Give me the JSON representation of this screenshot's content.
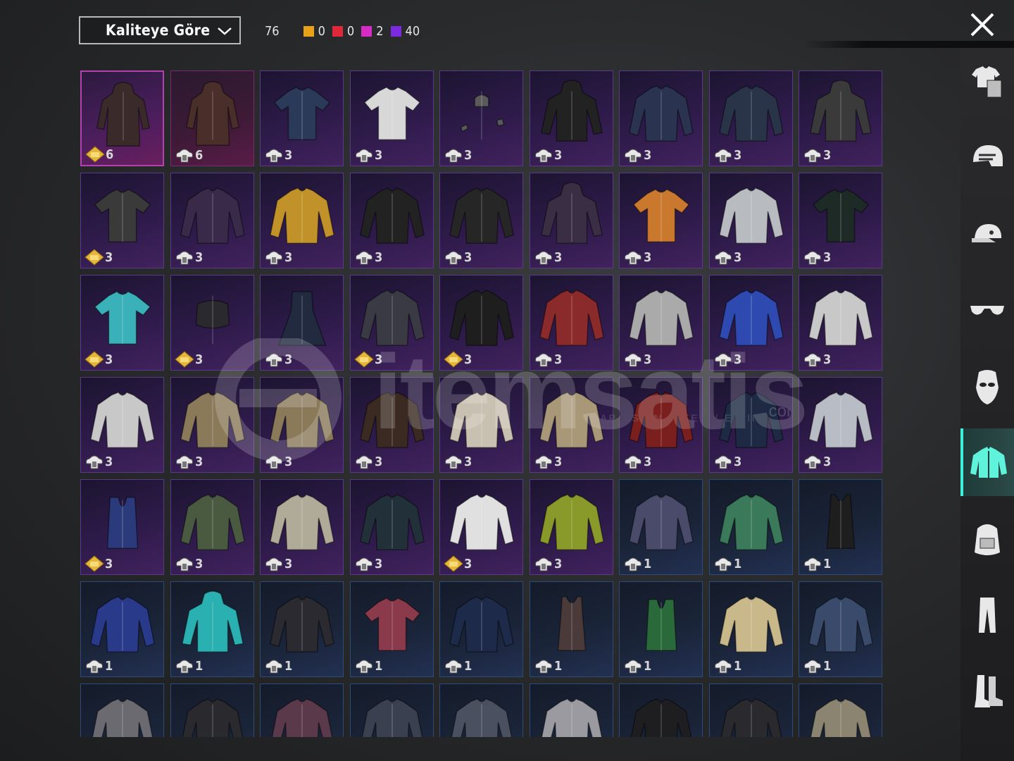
{
  "sort": {
    "label": "Kaliteye Göre"
  },
  "counts": {
    "total": "76",
    "items": [
      {
        "color": "#e8a21a",
        "value": "0"
      },
      {
        "color": "#e0283a",
        "value": "0"
      },
      {
        "color": "#d62bc4",
        "value": "2"
      },
      {
        "color": "#7b2ae0",
        "value": "40"
      }
    ]
  },
  "watermark": {
    "text": "itemsatis",
    "sub": "SAP / SKIN / ITEM / E-PIN",
    "com": ".com"
  },
  "sidebar": {
    "items": [
      {
        "name": "outfit",
        "icon": "outfit-icon",
        "active": false
      },
      {
        "name": "helmet",
        "icon": "helmet-icon",
        "active": false
      },
      {
        "name": "hat",
        "icon": "cap-icon",
        "active": false
      },
      {
        "name": "glasses",
        "icon": "glasses-icon",
        "active": false
      },
      {
        "name": "mask",
        "icon": "mask-icon",
        "active": false
      },
      {
        "name": "jacket",
        "icon": "jacket-icon",
        "active": true
      },
      {
        "name": "backpack",
        "icon": "backpack-icon",
        "active": false
      },
      {
        "name": "pants",
        "icon": "pants-icon",
        "active": false
      },
      {
        "name": "boots",
        "icon": "boots-icon",
        "active": false
      }
    ]
  },
  "inventory": [
    {
      "tier": "legendary",
      "badge": "gold",
      "qty": "6",
      "color": "#3a2a2a",
      "item": "hooded-coat"
    },
    {
      "tier": "legendary2",
      "badge": "silver",
      "qty": "6",
      "color": "#4a2e2a",
      "item": "long-coat"
    },
    {
      "tier": "epic",
      "badge": "silver",
      "qty": "3",
      "color": "#2c3a5a",
      "item": "tshirt"
    },
    {
      "tier": "epic",
      "badge": "silver",
      "qty": "3",
      "color": "#d8d8d8",
      "item": "tshirt"
    },
    {
      "tier": "epic",
      "badge": "silver",
      "qty": "3",
      "color": "#5a5a5a",
      "item": "accessory"
    },
    {
      "tier": "epic",
      "badge": "silver",
      "qty": "3",
      "color": "#222222",
      "item": "hoodie"
    },
    {
      "tier": "epic",
      "badge": "silver",
      "qty": "3",
      "color": "#2a3450",
      "item": "jacket"
    },
    {
      "tier": "epic",
      "badge": "silver",
      "qty": "3",
      "color": "#2a3448",
      "item": "sweater"
    },
    {
      "tier": "epic",
      "badge": "silver",
      "qty": "3",
      "color": "#3a3a3a",
      "item": "hoodie"
    },
    {
      "tier": "epic",
      "badge": "gold",
      "qty": "3",
      "color": "#3a3a3a",
      "item": "tshirt"
    },
    {
      "tier": "epic",
      "badge": "silver",
      "qty": "3",
      "color": "#3a2a4a",
      "item": "jacket"
    },
    {
      "tier": "epic",
      "badge": "silver",
      "qty": "3",
      "color": "#c2922a",
      "item": "jacket"
    },
    {
      "tier": "epic",
      "badge": "silver",
      "qty": "3",
      "color": "#222222",
      "item": "jacket"
    },
    {
      "tier": "epic",
      "badge": "silver",
      "qty": "3",
      "color": "#262626",
      "item": "jacket"
    },
    {
      "tier": "epic",
      "badge": "silver",
      "qty": "3",
      "color": "#3a2e44",
      "item": "hoodie"
    },
    {
      "tier": "epic",
      "badge": "silver",
      "qty": "3",
      "color": "#c9782e",
      "item": "tshirt"
    },
    {
      "tier": "epic",
      "badge": "silver",
      "qty": "3",
      "color": "#b8bcc0",
      "item": "shirt"
    },
    {
      "tier": "epic",
      "badge": "silver",
      "qty": "3",
      "color": "#1e2a26",
      "item": "tshirt"
    },
    {
      "tier": "epic",
      "badge": "gold",
      "qty": "3",
      "color": "#3ab0b8",
      "item": "tshirt"
    },
    {
      "tier": "epic",
      "badge": "gold",
      "qty": "3",
      "color": "#2a2a2e",
      "item": "top"
    },
    {
      "tier": "epic",
      "badge": "silver",
      "qty": "3",
      "color": "#222a40",
      "item": "dress"
    },
    {
      "tier": "epic",
      "badge": "gold",
      "qty": "3",
      "color": "#3a3a44",
      "item": "shirt"
    },
    {
      "tier": "epic",
      "badge": "gold",
      "qty": "3",
      "color": "#1e1e1e",
      "item": "jacket"
    },
    {
      "tier": "epic",
      "badge": "silver",
      "qty": "3",
      "color": "#8a2a2a",
      "item": "shirt"
    },
    {
      "tier": "epic",
      "badge": "silver",
      "qty": "3",
      "color": "#aaaaaa",
      "item": "jacket"
    },
    {
      "tier": "epic",
      "badge": "silver",
      "qty": "3",
      "color": "#2e4ab0",
      "item": "shirt"
    },
    {
      "tier": "epic",
      "badge": "silver",
      "qty": "3",
      "color": "#c8c8c8",
      "item": "jacket"
    },
    {
      "tier": "epic",
      "badge": "silver",
      "qty": "3",
      "color": "#c8c8c8",
      "item": "jacket"
    },
    {
      "tier": "epic",
      "badge": "silver",
      "qty": "3",
      "color": "#8a7a5a",
      "item": "jacket"
    },
    {
      "tier": "epic",
      "badge": "silver",
      "qty": "3",
      "color": "#8a7a5a",
      "item": "jacket"
    },
    {
      "tier": "epic",
      "badge": "silver",
      "qty": "3",
      "color": "#3a2a22",
      "item": "jacket"
    },
    {
      "tier": "epic",
      "badge": "silver",
      "qty": "3",
      "color": "#c8c0b0",
      "item": "shirt"
    },
    {
      "tier": "epic",
      "badge": "silver",
      "qty": "3",
      "color": "#a89878",
      "item": "shirt"
    },
    {
      "tier": "epic",
      "badge": "silver",
      "qty": "3",
      "color": "#7a1e1e",
      "item": "jacket"
    },
    {
      "tier": "epic",
      "badge": "silver",
      "qty": "3",
      "color": "#1e2a44",
      "item": "jacket"
    },
    {
      "tier": "epic",
      "badge": "silver",
      "qty": "3",
      "color": "#b8bcc4",
      "item": "jacket"
    },
    {
      "tier": "epic",
      "badge": "gold",
      "qty": "3",
      "color": "#2a3a7a",
      "item": "vest"
    },
    {
      "tier": "epic",
      "badge": "silver",
      "qty": "3",
      "color": "#4a5a40",
      "item": "sweater"
    },
    {
      "tier": "epic",
      "badge": "silver",
      "qty": "3",
      "color": "#b0aa98",
      "item": "jacket"
    },
    {
      "tier": "epic",
      "badge": "silver",
      "qty": "3",
      "color": "#22303a",
      "item": "jacket"
    },
    {
      "tier": "epic",
      "badge": "gold",
      "qty": "3",
      "color": "#e0e0e0",
      "item": "shirt"
    },
    {
      "tier": "epic",
      "badge": "silver",
      "qty": "3",
      "color": "#8a9a2a",
      "item": "jacket"
    },
    {
      "tier": "rare",
      "badge": "silver",
      "qty": "1",
      "color": "#4a4a6a",
      "item": "jacket"
    },
    {
      "tier": "rare",
      "badge": "silver",
      "qty": "1",
      "color": "#3a7a5a",
      "item": "shirt"
    },
    {
      "tier": "rare",
      "badge": "silver",
      "qty": "1",
      "color": "#1e1e1e",
      "item": "tank"
    },
    {
      "tier": "rare",
      "badge": "silver",
      "qty": "1",
      "color": "#2a3a8a",
      "item": "jacket"
    },
    {
      "tier": "rare",
      "badge": "silver",
      "qty": "1",
      "color": "#2ab0b0",
      "item": "hoodie"
    },
    {
      "tier": "rare",
      "badge": "silver",
      "qty": "1",
      "color": "#2a2a30",
      "item": "jacket"
    },
    {
      "tier": "rare",
      "badge": "silver",
      "qty": "1",
      "color": "#8a3a4a",
      "item": "tshirt"
    },
    {
      "tier": "rare",
      "badge": "silver",
      "qty": "1",
      "color": "#1e2a4a",
      "item": "shirt"
    },
    {
      "tier": "rare",
      "badge": "silver",
      "qty": "1",
      "color": "#4a3a3a",
      "item": "tank"
    },
    {
      "tier": "rare",
      "badge": "silver",
      "qty": "1",
      "color": "#2a6a3a",
      "item": "vest"
    },
    {
      "tier": "rare",
      "badge": "silver",
      "qty": "1",
      "color": "#c8b88a",
      "item": "shirt"
    },
    {
      "tier": "rare",
      "badge": "silver",
      "qty": "1",
      "color": "#3a4a6a",
      "item": "jacket"
    },
    {
      "tier": "rare",
      "badge": "none",
      "qty": "",
      "color": "#6a6a70",
      "item": "jacket"
    },
    {
      "tier": "rare",
      "badge": "none",
      "qty": "",
      "color": "#2a2a2e",
      "item": "jacket"
    },
    {
      "tier": "rare",
      "badge": "none",
      "qty": "",
      "color": "#5a3a4a",
      "item": "jacket"
    },
    {
      "tier": "rare",
      "badge": "none",
      "qty": "",
      "color": "#3a4050",
      "item": "jacket"
    },
    {
      "tier": "rare",
      "badge": "none",
      "qty": "",
      "color": "#4a5060",
      "item": "jacket"
    },
    {
      "tier": "rare",
      "badge": "none",
      "qty": "",
      "color": "#9a9aa0",
      "item": "jacket"
    },
    {
      "tier": "rare",
      "badge": "none",
      "qty": "",
      "color": "#1e1e20",
      "item": "jacket"
    },
    {
      "tier": "rare",
      "badge": "none",
      "qty": "",
      "color": "#2a2a2e",
      "item": "jacket"
    },
    {
      "tier": "rare",
      "badge": "none",
      "qty": "",
      "color": "#8a8470",
      "item": "jacket"
    }
  ]
}
